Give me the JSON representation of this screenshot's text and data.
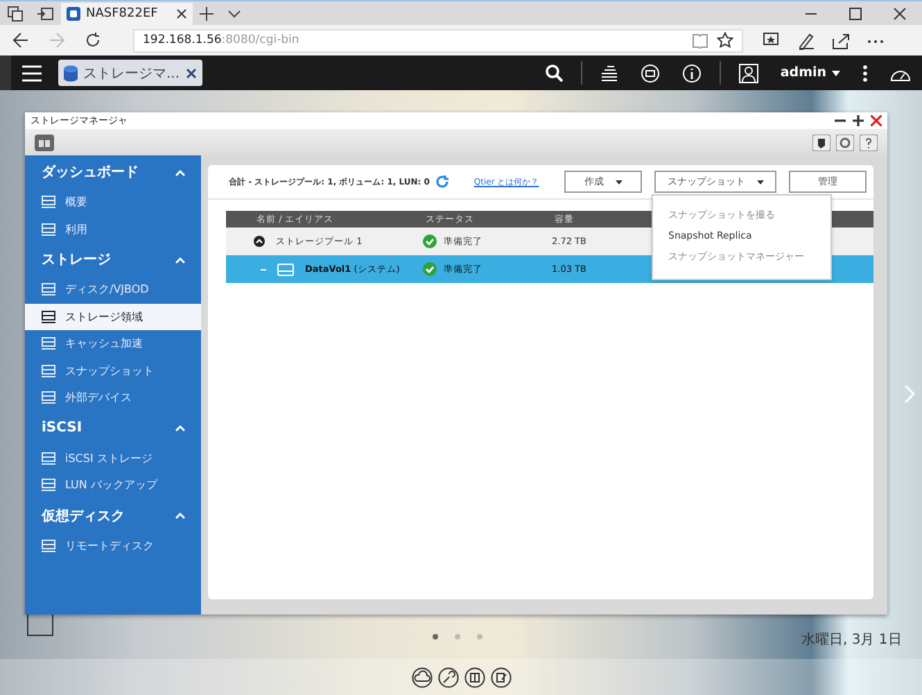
{
  "browser": {
    "tabs": [
      {
        "title": "NASF822EF",
        "selected": true
      }
    ],
    "url_host": "192.168.1.56",
    "url_path": ":8080/cgi-bin"
  },
  "top_bar": {
    "app_tabs": [
      {
        "label": "ストレージマ...",
        "selected": true
      }
    ],
    "user": "admin"
  },
  "window": {
    "title": "ストレージマネージャ"
  },
  "sidebar": [
    {
      "title": "ダッシュボード",
      "expanded": true,
      "items": [
        {
          "label": "概要",
          "selected": false
        },
        {
          "label": "利用",
          "selected": false
        }
      ]
    },
    {
      "title": "ストレージ",
      "expanded": true,
      "items": [
        {
          "label": "ディスク/VJBOD",
          "selected": false
        },
        {
          "label": "ストレージ領域",
          "selected": true
        },
        {
          "label": "キャッシュ加速",
          "selected": false
        },
        {
          "label": "スナップショット",
          "selected": false
        },
        {
          "label": "外部デバイス",
          "selected": false
        }
      ]
    },
    {
      "title": "iSCSI",
      "expanded": true,
      "items": [
        {
          "label": "iSCSI ストレージ",
          "selected": false
        },
        {
          "label": "LUN バックアップ",
          "selected": false
        }
      ]
    },
    {
      "title": "仮想ディスク",
      "expanded": true,
      "items": [
        {
          "label": "リモートディスク",
          "selected": false
        }
      ]
    }
  ],
  "summary": "合計 - ストレージプール: 1, ボリューム: 1, LUN: 0",
  "help_link": "Qtier とは何か？",
  "buttons": [
    {
      "label": "作成",
      "dropdown": true
    },
    {
      "label": "スナップショット",
      "dropdown": true
    },
    {
      "label": "管理",
      "dropdown": false
    }
  ],
  "table": {
    "columns": [
      "名前 / エイリアス",
      "ステータス",
      "容量"
    ],
    "rows": [
      {
        "name": "ストレージプール 1",
        "status": "準備完了",
        "capacity": "2.72 TB",
        "selected": false,
        "expanded": true,
        "children": [
          {
            "name": "**DataVol1** (システム)",
            "status": "準備完了",
            "capacity": "1.03 TB",
            "selected": true
          }
        ]
      }
    ]
  },
  "menu": [
    {
      "label": "スナップショットを撮る",
      "disabled": true
    },
    {
      "label": "Snapshot Replica",
      "disabled": false
    },
    {
      "label": "スナップショットマネージャー",
      "disabled": true
    }
  ],
  "desktop": {
    "date": "水曜日, 3月 1日",
    "pages": [
      {
        "selected": true
      },
      {
        "selected": false
      },
      {
        "selected": false
      }
    ]
  }
}
